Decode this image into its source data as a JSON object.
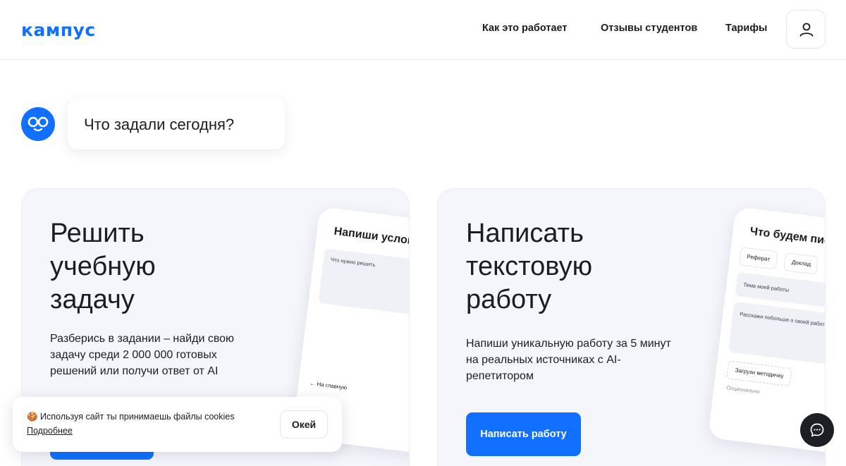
{
  "header": {
    "logo": "кампус",
    "nav": [
      "Как это работает",
      "Отзывы студентов",
      "Тарифы"
    ],
    "profile_icon": "user-icon"
  },
  "greeting": {
    "text": "Что задали сегодня?",
    "avatar_icon": "bot-face-icon"
  },
  "cards": [
    {
      "title": "Решить учебную задачу",
      "description": "Разберись в задании – найди свою задачу среди 2 000 000 готовых решений или получи ответ от AI",
      "mockup": {
        "title": "Напиши условие",
        "field_placeholder": "Что нужно решить",
        "back_label": "← На главную"
      }
    },
    {
      "title": "Написать текстовую работу",
      "description": "Напиши уникальную работу за 5 минут на реальных источниках с AI-репетитором",
      "button": "Написать работу",
      "mockup": {
        "title": "Что будем писать",
        "chips": [
          "Реферат",
          "Доклад"
        ],
        "topic_placeholder": "Тема моей работы",
        "details_placeholder": "Расскажи побольше о своей работе",
        "upload_label": "Загрузи методичку",
        "optional_label": "Опционально"
      }
    }
  ],
  "cookie": {
    "text": "🍪 Используя сайт ты принимаешь файлы cookies",
    "link": "Подробнее",
    "ok": "Окей"
  },
  "chat": {
    "icon": "chat-bubble-icon"
  },
  "colors": {
    "accent": "#1170ff",
    "card_bg": "#f4f6fb",
    "dark": "#1c1f24"
  }
}
